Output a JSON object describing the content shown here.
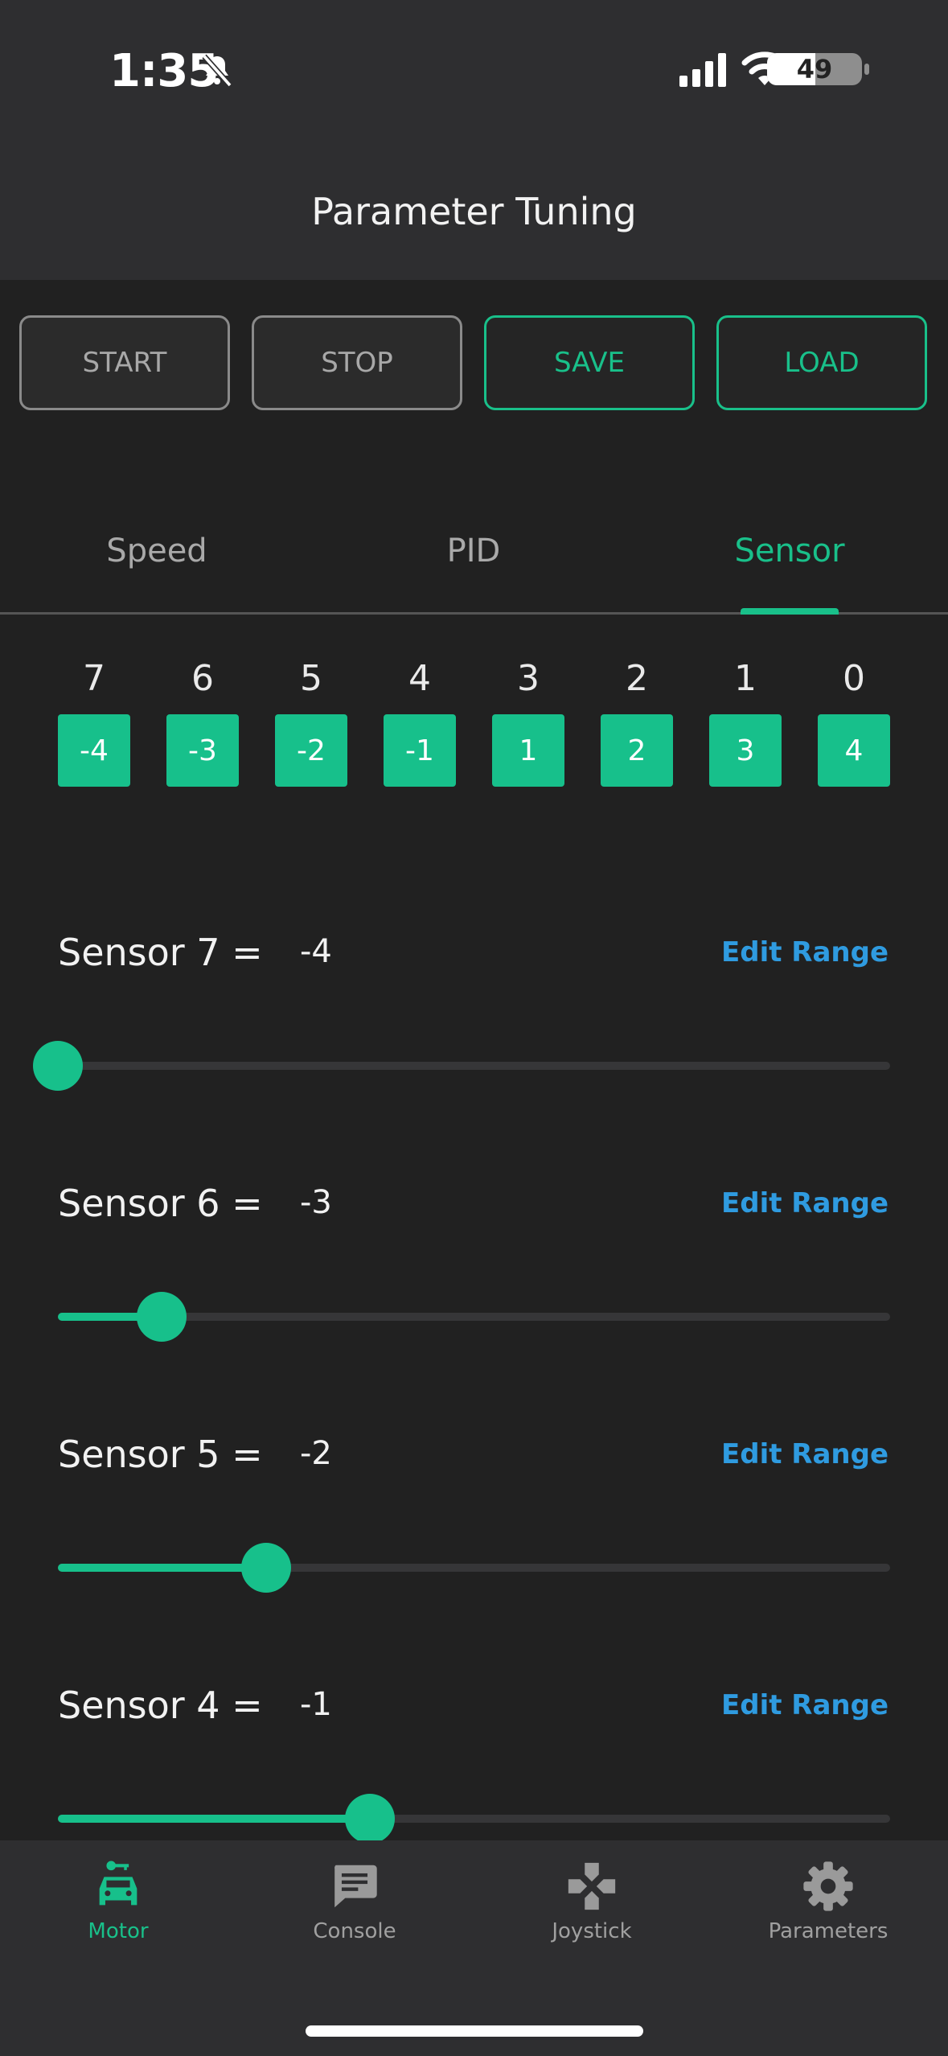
{
  "status": {
    "time": "1:35",
    "battery": "49"
  },
  "header": {
    "title": "Parameter Tuning"
  },
  "controls": {
    "start": "START",
    "stop": "STOP",
    "save": "SAVE",
    "load": "LOAD"
  },
  "tabs": [
    {
      "label": "Speed"
    },
    {
      "label": "PID"
    },
    {
      "label": "Sensor"
    }
  ],
  "active_tab": "Sensor",
  "sensor_grid": {
    "indices": [
      "7",
      "6",
      "5",
      "4",
      "3",
      "2",
      "1",
      "0"
    ],
    "weights": [
      "-4",
      "-3",
      "-2",
      "-1",
      "1",
      "2",
      "3",
      "4"
    ]
  },
  "sensors": [
    {
      "label": "Sensor 7 =",
      "value": "-4",
      "edit": "Edit Range",
      "level": 0.0
    },
    {
      "label": "Sensor 6 =",
      "value": "-3",
      "edit": "Edit Range",
      "level": 0.125
    },
    {
      "label": "Sensor 5 =",
      "value": "-2",
      "edit": "Edit Range",
      "level": 0.25
    },
    {
      "label": "Sensor 4 =",
      "value": "-1",
      "edit": "Edit Range",
      "level": 0.375
    }
  ],
  "nav": [
    {
      "label": "Motor",
      "icon": "car-key-icon"
    },
    {
      "label": "Console",
      "icon": "chat-icon"
    },
    {
      "label": "Joystick",
      "icon": "gamepad-icon"
    },
    {
      "label": "Parameters",
      "icon": "gear-icon"
    }
  ],
  "colors": {
    "accent": "#17c08b",
    "link": "#2f9be0",
    "background": "#212121",
    "bar": "#2e2e30"
  }
}
